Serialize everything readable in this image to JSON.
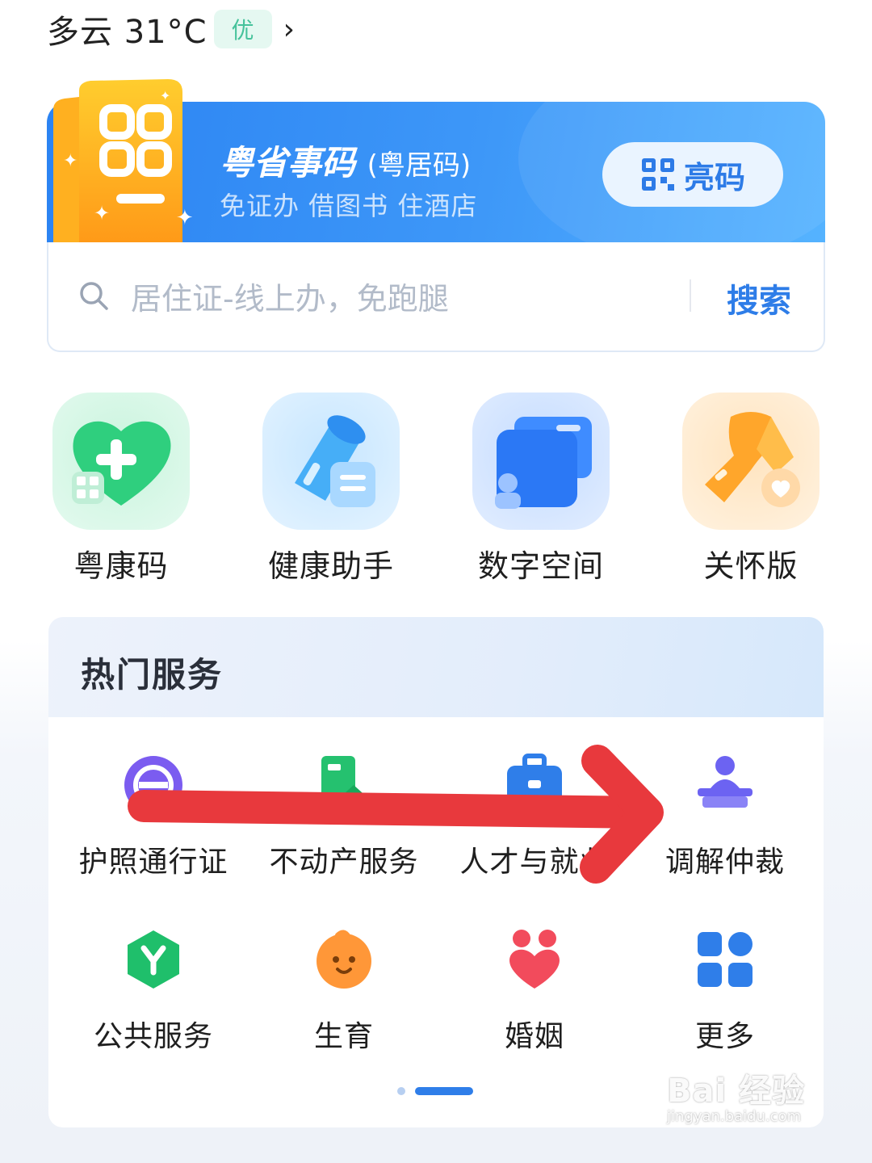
{
  "weather": {
    "text": "多云 31°C",
    "aqi": "优",
    "chevron": "›"
  },
  "code_card": {
    "title": "粤省事码",
    "title_sub": "(粤居码)",
    "subtitle": "免证办 借图书 住酒店",
    "button_label": "亮码"
  },
  "search": {
    "placeholder": "居住证-线上办，免跑腿",
    "button_label": "搜索"
  },
  "quick_apps": [
    {
      "label": "粤康码",
      "icon": "health-code-heart-icon"
    },
    {
      "label": "健康助手",
      "icon": "health-assistant-icon"
    },
    {
      "label": "数字空间",
      "icon": "digital-space-wallet-icon"
    },
    {
      "label": "关怀版",
      "icon": "care-ribbon-icon"
    }
  ],
  "hot_services": {
    "title": "热门服务",
    "items": [
      {
        "label": "护照通行证",
        "icon": "passport-icon"
      },
      {
        "label": "不动产服务",
        "icon": "real-estate-icon"
      },
      {
        "label": "人才与就业",
        "icon": "briefcase-icon"
      },
      {
        "label": "调解仲裁",
        "icon": "mediation-icon"
      },
      {
        "label": "公共服务",
        "icon": "public-service-icon"
      },
      {
        "label": "生育",
        "icon": "baby-icon"
      },
      {
        "label": "婚姻",
        "icon": "marriage-heart-icon"
      },
      {
        "label": "更多",
        "icon": "more-grid-icon"
      }
    ],
    "pager": {
      "pages": 2,
      "current": 2
    }
  },
  "colors": {
    "accent": "#2e7de8",
    "arrow": "#e8393d",
    "aqi_green": "#46c29b"
  },
  "watermark": {
    "line1": "Bai 经验",
    "line2": "jingyan.baidu.com"
  }
}
